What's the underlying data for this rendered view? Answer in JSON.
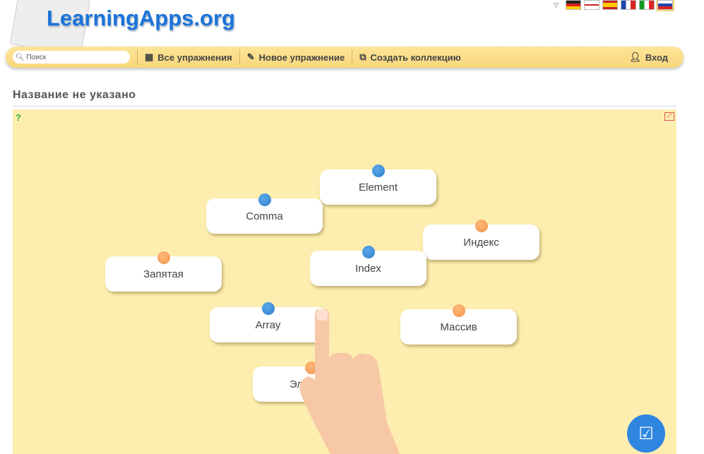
{
  "header": {
    "logo": "LearningApps.org",
    "languages": [
      "de",
      "en",
      "es",
      "fr",
      "it",
      "ru"
    ]
  },
  "nav": {
    "search_placeholder": "Поиск",
    "all": "Все упражнения",
    "new": "Новое упражнение",
    "collection": "Создать коллекцию",
    "login": "Вход"
  },
  "page": {
    "title": "Название не указано"
  },
  "cards": [
    {
      "label": "Element",
      "dot": "blue"
    },
    {
      "label": "Comma",
      "dot": "blue"
    },
    {
      "label": "Индекс",
      "dot": "orange"
    },
    {
      "label": "Запятая",
      "dot": "orange"
    },
    {
      "label": "Index",
      "dot": "blue"
    },
    {
      "label": "Array",
      "dot": "blue"
    },
    {
      "label": "Массив",
      "dot": "orange"
    },
    {
      "label": "Элемент",
      "dot": "orange"
    }
  ],
  "colors": {
    "blue": "#3a8fd6",
    "orange": "#f5a05a",
    "stage": "#fdeeb0"
  }
}
